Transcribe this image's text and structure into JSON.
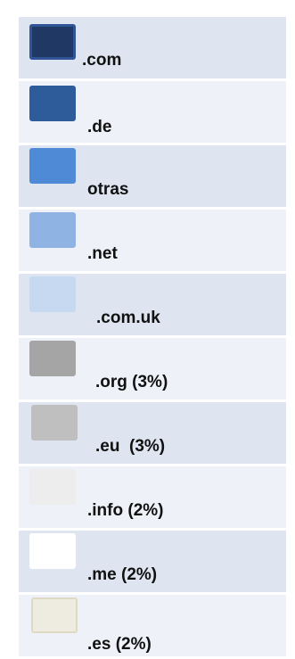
{
  "chart_data": {
    "type": "pie",
    "legend": [
      {
        "label": ".com",
        "color": "#1f3864",
        "border": "#2f5597"
      },
      {
        "label": ".de",
        "color": "#2e5c9a",
        "border": "#2e5c9a"
      },
      {
        "label": "otras",
        "color": "#4f8ad6",
        "border": "#4f8ad6"
      },
      {
        "label": ".net",
        "color": "#8fb4e3",
        "border": "#8fb4e3"
      },
      {
        "label": ".com.uk",
        "color": "#c6d9f1",
        "border": "#c6d9f1"
      },
      {
        "label": ".org (3%)",
        "color": "#a5a5a5",
        "border": "#a5a5a5"
      },
      {
        "label": ".eu  (3%)",
        "color": "#bfbfbf",
        "border": "#bfbfbf"
      },
      {
        "label": ".info (2%)",
        "color": "#ededed",
        "border": "#ededed"
      },
      {
        "label": ".me (2%)",
        "color": "#ffffff",
        "border": "#ffffff"
      },
      {
        "label": ".es (2%)",
        "color": "#eeece1",
        "border": "#ddd9c3"
      }
    ]
  }
}
